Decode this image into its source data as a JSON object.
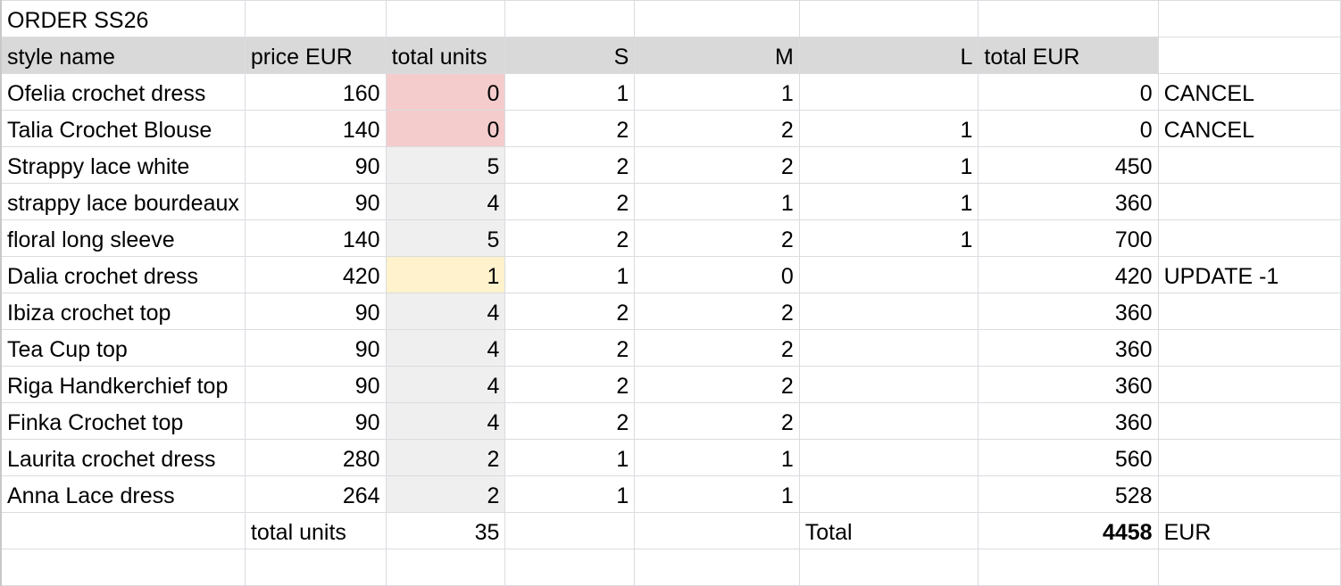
{
  "title": "ORDER SS26",
  "headers": {
    "style_name": "style name",
    "price": "price EUR",
    "total_units": "total units",
    "s": "S",
    "m": "M",
    "l": "L",
    "total_eur": "total EUR"
  },
  "rows": [
    {
      "style": "Ofelia crochet dress",
      "price": "160",
      "units": "0",
      "s": "1",
      "m": "1",
      "l": "",
      "total": "0",
      "note": "CANCEL"
    },
    {
      "style": "Talia Crochet Blouse",
      "price": "140",
      "units": "0",
      "s": "2",
      "m": "2",
      "l": "1",
      "total": "0",
      "note": "CANCEL"
    },
    {
      "style": "Strappy lace white",
      "price": "90",
      "units": "5",
      "s": "2",
      "m": "2",
      "l": "1",
      "total": "450",
      "note": ""
    },
    {
      "style": "strappy lace bourdeaux",
      "price": "90",
      "units": "4",
      "s": "2",
      "m": "1",
      "l": "1",
      "total": "360",
      "note": ""
    },
    {
      "style": "floral long sleeve",
      "price": "140",
      "units": "5",
      "s": "2",
      "m": "2",
      "l": "1",
      "total": "700",
      "note": ""
    },
    {
      "style": "Dalia crochet dress",
      "price": "420",
      "units": "1",
      "s": "1",
      "m": "0",
      "l": "",
      "total": "420",
      "note": "UPDATE -1"
    },
    {
      "style": "Ibiza crochet top",
      "price": "90",
      "units": "4",
      "s": "2",
      "m": "2",
      "l": "",
      "total": "360",
      "note": ""
    },
    {
      "style": "Tea Cup top",
      "price": "90",
      "units": "4",
      "s": "2",
      "m": "2",
      "l": "",
      "total": "360",
      "note": ""
    },
    {
      "style": "Riga Handkerchief top",
      "price": "90",
      "units": "4",
      "s": "2",
      "m": "2",
      "l": "",
      "total": "360",
      "note": ""
    },
    {
      "style": "Finka Crochet top",
      "price": "90",
      "units": "4",
      "s": "2",
      "m": "2",
      "l": "",
      "total": "360",
      "note": ""
    },
    {
      "style": "Laurita crochet dress",
      "price": "280",
      "units": "2",
      "s": "1",
      "m": "1",
      "l": "",
      "total": "560",
      "note": ""
    },
    {
      "style": "Anna Lace dress",
      "price": "264",
      "units": "2",
      "s": "1",
      "m": "1",
      "l": "",
      "total": "528",
      "note": ""
    }
  ],
  "footer": {
    "units_label": "total units",
    "units_value": "35",
    "total_label": "Total",
    "total_value": "4458",
    "currency": "EUR"
  },
  "colors": {
    "header_bg": "#d9d9d9",
    "cancel_bg": "#f4cccc",
    "update_bg": "#fff2cc",
    "units_bg": "#efefef",
    "gridline": "#dadce0"
  }
}
